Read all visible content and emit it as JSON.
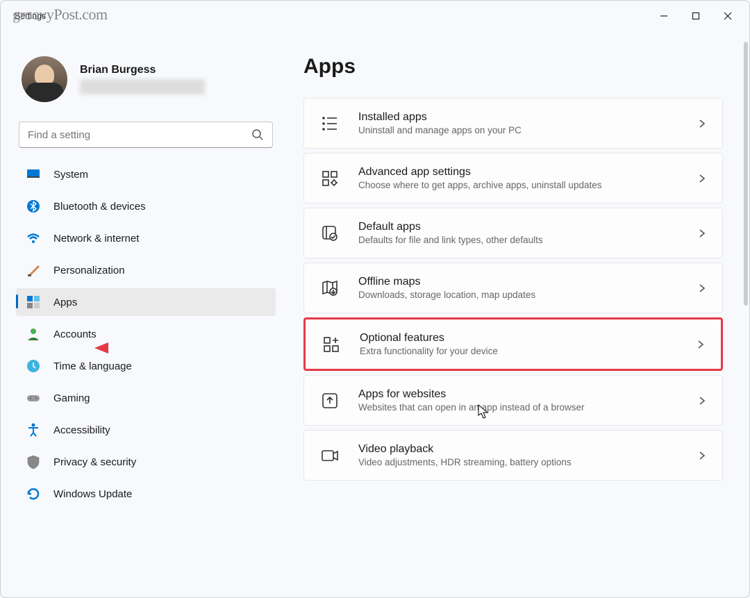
{
  "watermark": "groovyPost.com",
  "app_title": "Settings",
  "profile": {
    "name": "Brian Burgess"
  },
  "search": {
    "placeholder": "Find a setting"
  },
  "sidebar": {
    "items": [
      {
        "label": "System"
      },
      {
        "label": "Bluetooth & devices"
      },
      {
        "label": "Network & internet"
      },
      {
        "label": "Personalization"
      },
      {
        "label": "Apps"
      },
      {
        "label": "Accounts"
      },
      {
        "label": "Time & language"
      },
      {
        "label": "Gaming"
      },
      {
        "label": "Accessibility"
      },
      {
        "label": "Privacy & security"
      },
      {
        "label": "Windows Update"
      }
    ]
  },
  "page": {
    "title": "Apps"
  },
  "cards": [
    {
      "title": "Installed apps",
      "desc": "Uninstall and manage apps on your PC"
    },
    {
      "title": "Advanced app settings",
      "desc": "Choose where to get apps, archive apps, uninstall updates"
    },
    {
      "title": "Default apps",
      "desc": "Defaults for file and link types, other defaults"
    },
    {
      "title": "Offline maps",
      "desc": "Downloads, storage location, map updates"
    },
    {
      "title": "Optional features",
      "desc": "Extra functionality for your device"
    },
    {
      "title": "Apps for websites",
      "desc": "Websites that can open in an app instead of a browser"
    },
    {
      "title": "Video playback",
      "desc": "Video adjustments, HDR streaming, battery options"
    }
  ]
}
